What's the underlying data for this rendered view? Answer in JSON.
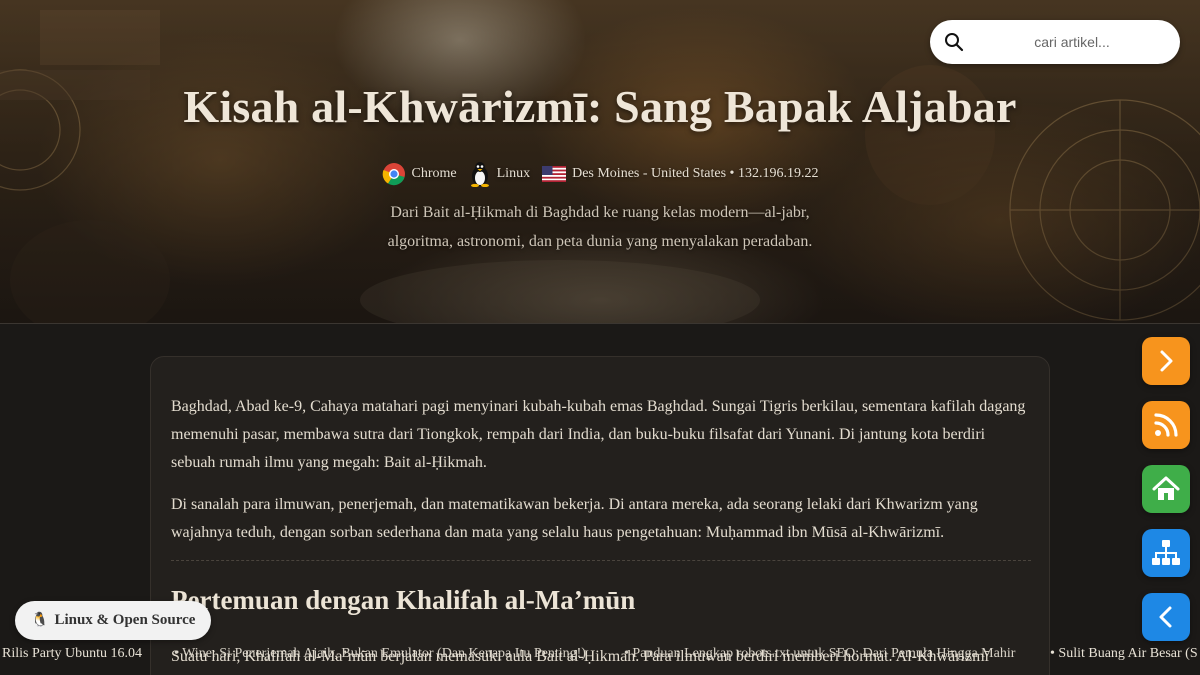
{
  "search": {
    "placeholder": "cari artikel..."
  },
  "hero": {
    "title": "Kisah al-Khwārizmī: Sang Bapak Aljabar",
    "meta": {
      "browser": "Chrome",
      "os": "Linux",
      "location": "Des Moines - United States • 132.196.19.22"
    },
    "description_line1": "Dari Bait al-Ḥikmah di Baghdad ke ruang kelas modern—al-jabr,",
    "description_line2": "algoritma, astronomi, dan peta dunia yang menyalakan peradaban."
  },
  "article": {
    "paragraph1": "Baghdad, Abad ke-9, Cahaya matahari pagi menyinari kubah-kubah emas Baghdad. Sungai Tigris berkilau, sementara kafilah dagang memenuhi pasar, membawa sutra dari Tiongkok, rempah dari India, dan buku-buku filsafat dari Yunani. Di jantung kota berdiri sebuah rumah ilmu yang megah: Bait al-Ḥikmah.",
    "paragraph2": "Di sanalah para ilmuwan, penerjemah, dan matematikawan bekerja. Di antara mereka, ada seorang lelaki dari Khwarizm yang wajahnya teduh, dengan sorban sederhana dan mata yang selalu haus pengetahuan: Muḥammad ibn Mūsā al-Khwārizmī.",
    "section_heading": "Pertemuan dengan Khalifah al-Ma’mūn",
    "paragraph3": "Suatu hari, Khalifah al-Ma’mūn berjalan memasuki aula Bait al-Ḥikmah. Para ilmuwan berdiri memberi hormat. Al-Khwārizmī"
  },
  "category_pill": {
    "label": "Linux & Open Source",
    "icon": "🐧"
  },
  "ticker": [
    "Rilis Party Ubuntu 16.04",
    "• Wine: Si Penerjemah Ajaib, Bukan Emulator (Dan Kenapa Itu Penting!)",
    "• Panduan Lengkap robots.txt untuk SEO: Dari Pemula Hingga Mahir",
    "• Sulit Buang Air Besar (S"
  ],
  "floating_buttons": {
    "next": "next-article",
    "rss": "rss-feed",
    "home": "home",
    "sitemap": "sitemap",
    "prev": "previous-article"
  },
  "colors": {
    "orange": "#f7941d",
    "green": "#3fae49",
    "blue": "#1e88e5",
    "card_bg": "#23201d",
    "page_bg": "#1b1917"
  }
}
